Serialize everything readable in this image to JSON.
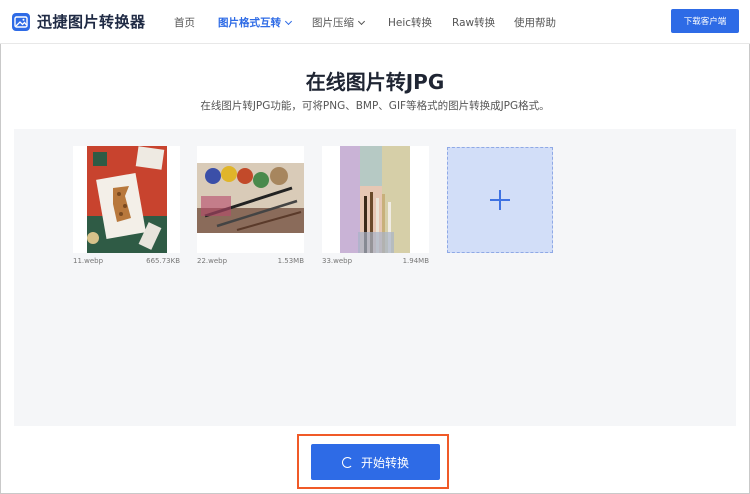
{
  "app": {
    "name": "迅捷图片转换器"
  },
  "nav": {
    "items": [
      {
        "label": "首页"
      },
      {
        "label": "图片格式互转"
      },
      {
        "label": "图片压缩"
      },
      {
        "label": "Heic转换"
      },
      {
        "label": "Raw转换"
      },
      {
        "label": "使用帮助"
      }
    ],
    "download_label": "下载客户端"
  },
  "main": {
    "title": "在线图片转JPG",
    "subtitle": "在线图片转JPG功能，可将PNG、BMP、GIF等格式的图片转换成JPG格式。"
  },
  "files": [
    {
      "name": "11.webp",
      "size": "665.73KB"
    },
    {
      "name": "22.webp",
      "size": "1.53MB"
    },
    {
      "name": "33.webp",
      "size": "1.94MB"
    }
  ],
  "actions": {
    "start_label": "开始转换"
  },
  "colors": {
    "accent": "#2e6be6",
    "highlight": "#f05a28",
    "panel": "#f5f6f8",
    "add_tile": "#d2def8"
  }
}
